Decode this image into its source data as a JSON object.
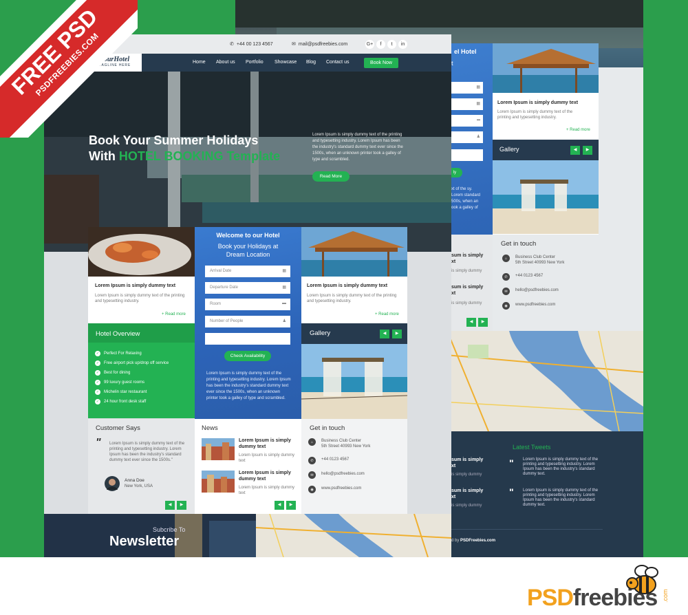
{
  "colors": {
    "green": "#23b253",
    "navy": "#263a4e",
    "blue": "#2f67b8",
    "red": "#d62a2a",
    "bg_green": "#2b9e4c"
  },
  "banner": {
    "line1": "FREE PSD",
    "line2": "PSDFREEBIES.COM"
  },
  "brand": {
    "text_psd": "PSD",
    "text_freebies": "freebies",
    "text_com": ".com",
    "icon": "bee-icon"
  },
  "topbar": {
    "phone": "+44 00 123 4567",
    "email": "mail@psdfreebies.com",
    "social": [
      "G+",
      "f",
      "t",
      "in"
    ]
  },
  "logo": {
    "title": "YourHotel",
    "tagline": "TAGLINE HERE"
  },
  "nav": {
    "items": [
      "Home",
      "About us",
      "Portfolio",
      "Showcase",
      "Blog",
      "Contact us"
    ],
    "cta": "Book Now"
  },
  "hero": {
    "title_line1": "Book Your Summer Holidays",
    "title_line2_prefix": "With ",
    "title_line2_highlight": "HOTEL BOOKING Template",
    "description": "Lorem Ipsum is simply dummy text of the printing and typesetting industry. Lorem Ipsum has been the industry's standard dummy text ever since the 1500s, when an unknown printer took a galley of type and scrambled.",
    "button": "Read More"
  },
  "card_left": {
    "title": "Lorem Ipsum is simply dummy text",
    "text": "Lorem Ipsum is simply dummy text of the printing and typesetting industry.",
    "more": "+ Read more"
  },
  "card_right": {
    "title": "Lorem Ipsum is simply dummy text",
    "text": "Lorem Ipsum is simply dummy text of the printing and typesetting industry.",
    "more": "+ Read more"
  },
  "welcome": {
    "title": "Welcome to our Hotel",
    "subtitle_line1": "Book your Holidays at",
    "subtitle_line2": "Dream Location",
    "fields": [
      "Arrival Date",
      "Departure Date",
      "Room",
      "Number of People",
      ""
    ],
    "button": "Check Availability",
    "text": "Lorem Ipsum is simply dummy text of the printing and typesetting industry. Lorem Ipsum has been the industry's standard dummy text ever since the 1500s, when an unknown printer took a galley of type and scrambled."
  },
  "overview": {
    "title": "Hotel Overview",
    "items": [
      "Perfect For Relaxing",
      "Free airport pick up/drop off service",
      "Best for dining",
      "99 luxury guest rooms",
      "Michelin star restaurant",
      "24 hour front desk staff"
    ]
  },
  "gallery": {
    "title": "Gallery",
    "prev": "◀",
    "next": "▶"
  },
  "customer": {
    "title": "Customer Says",
    "quote": "Lorem Ipsum is simply dummy text of the printing and typesetting industry. Lorem Ipsum has been the industry's standard dummy text ever since the 1500s.\"",
    "name": "Anna Doe",
    "location": "New York, USA"
  },
  "news": {
    "title": "News",
    "items": [
      {
        "title": "Lorem Ipsum is simply dummy text",
        "text": "Lorem Ipsum is simply dummy text"
      },
      {
        "title": "Lorem Ipsum is simply dummy text",
        "text": "Lorem Ipsum is simply dummy text"
      }
    ]
  },
  "contact": {
    "title": "Get in touch",
    "address_line1": "Business Club Center",
    "address_line2": "5th Street 40993 New York",
    "phone": "+44 0123 4567",
    "email": "hello@psdfreebies.com",
    "web": "www.psdfreebies.com"
  },
  "newsletter": {
    "subtitle": "Subcribe To",
    "title": "Newsletter"
  },
  "back": {
    "logo_fragment": "el Hotel",
    "logo_fragment2": "t",
    "card_title": "Lorem Ipsum is simply dummy text",
    "card_text": "Lorem Ipsum is simply dummy text of the printing and typesetting industry.",
    "card_more": "+ Read more",
    "gallery": "Gallery",
    "contact_title": "Get in touch",
    "address_line1": "Business Club Center",
    "address_line2": "5th Street 40993 New York",
    "phone": "+44 0123 4567",
    "email": "hello@psdfreebies.com",
    "web": "www.psdfreebies.com",
    "news_fragment_title": "sum is simply",
    "news_fragment_title2": "xt",
    "news_fragment_text": "is simply dummy",
    "tweets_title": "Latest Tweets",
    "tweets": [
      "Lorem Ipsum is simply dummy text of the printing and typesetting industry. Lorem Ipsum has been the industry's standard dummy text.",
      "Lorem Ipsum is simply dummy text of the printing and typesetting industry. Lorem Ipsum has been the industry's standard dummy text."
    ],
    "footer_credit_prefix": "d by ",
    "footer_credit_brand": "PSDFreebies.com",
    "welcome_fragment": "ly",
    "welcome_text_fragment": "xt of the sy. Lorem standard 500s, when an ook a galley of"
  }
}
